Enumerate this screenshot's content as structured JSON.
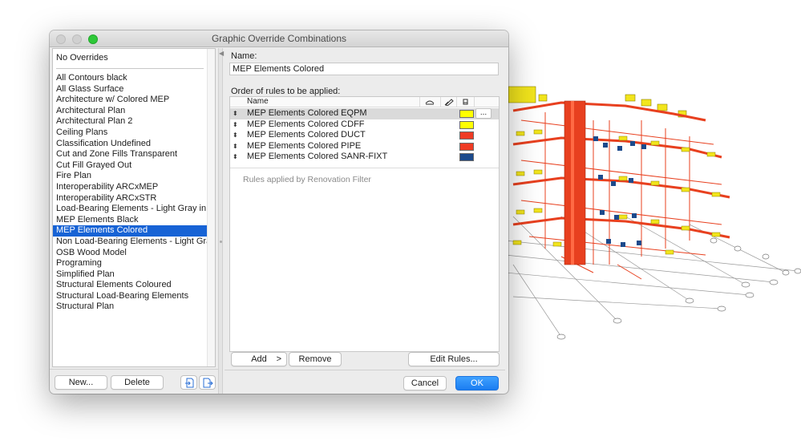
{
  "window": {
    "title": "Graphic Override Combinations"
  },
  "combinations": {
    "no_overrides": "No Overrides",
    "items": [
      "All Contours black",
      "All Glass Surface",
      "Architecture w/ Colored MEP",
      "Architectural Plan",
      "Architectural Plan 2",
      "Ceiling Plans",
      "Classification Undefined",
      "Cut and Zone Fills Transparent",
      "Cut Fill Grayed Out",
      "Fire Plan",
      "Interoperability ARCxMEP",
      "Interoperability ARCxSTR",
      "Load-Bearing Elements - Light Gray in Plans",
      "MEP Elements Black",
      "MEP Elements Colored",
      "Non Load-Bearing Elements - Light Gray in Pla...",
      "OSB Wood Model",
      "Programing",
      "Simplified Plan",
      "Structural Elements Coloured",
      "Structural Load-Bearing Elements",
      "Structural Plan"
    ],
    "selected_index": 14
  },
  "left_buttons": {
    "new_label": "New...",
    "delete_label": "Delete",
    "import_icon": "import-icon",
    "export_icon": "export-icon"
  },
  "name": {
    "label": "Name:",
    "value": "MEP Elements Colored"
  },
  "rules": {
    "label": "Order of rules to be applied:",
    "header_name": "Name",
    "header_icons": [
      "eye-icon",
      "pen-icon",
      "fill-icon"
    ],
    "rows": [
      {
        "name": "MEP Elements Colored EQPM",
        "color": "#ffff00"
      },
      {
        "name": "MEP Elements Colored CDFF",
        "color": "#ffff00"
      },
      {
        "name": "MEP Elements Colored DUCT",
        "color": "#ef3b24"
      },
      {
        "name": "MEP Elements Colored PIPE",
        "color": "#ef3b24"
      },
      {
        "name": "MEP Elements Colored SANR-FIXT",
        "color": "#1c4a8c"
      }
    ],
    "selected_index": 0,
    "ellipsis": "...",
    "renovation_text": "Rules applied by Renovation Filter"
  },
  "right_buttons": {
    "add_label": "Add",
    "add_chevron": ">",
    "remove_label": "Remove",
    "edit_rules_label": "Edit Rules...",
    "cancel_label": "Cancel",
    "ok_label": "OK"
  },
  "colors": {
    "selection": "#1763d5",
    "accent": "#1b7df1",
    "mep_red": "#ef3b24",
    "mep_yellow": "#ffff00",
    "mep_blue": "#1c4a8c"
  }
}
